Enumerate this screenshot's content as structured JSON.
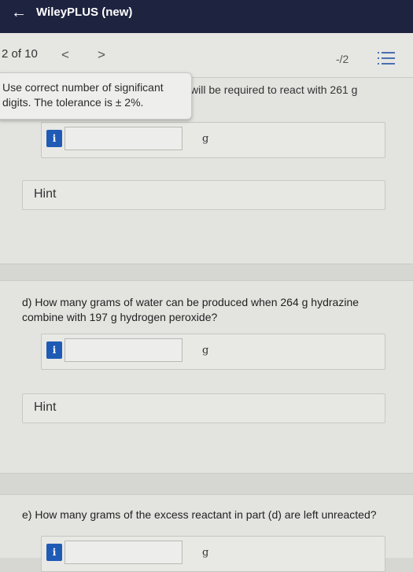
{
  "header": {
    "back_icon": "arrow-left-icon",
    "title": "WileyPLUS (new)"
  },
  "toolbar": {
    "question_count": "2 of 10",
    "prev": "<",
    "next": ">",
    "score": "-/2",
    "list_icon": "list-icon"
  },
  "tooltip": {
    "text": "Use correct number of significant digits. The tolerance is ± 2%."
  },
  "part_c": {
    "question_fragment": "will be required to react with 261 g",
    "input_value": "",
    "unit": "g",
    "hint_label": "Hint"
  },
  "part_d": {
    "question": "d) How many grams of water can be produced when 264 g hydrazine combine with 197 g hydrogen peroxide?",
    "input_value": "",
    "unit": "g",
    "hint_label": "Hint"
  },
  "part_e": {
    "question": "e) How many grams of the excess reactant in part (d) are left unreacted?",
    "input_value": "",
    "unit": "g"
  },
  "info_label": "i",
  "colors": {
    "header_bg": "#1e2340",
    "info_button": "#1f5bb5",
    "page_bg": "#d6d6d2"
  }
}
